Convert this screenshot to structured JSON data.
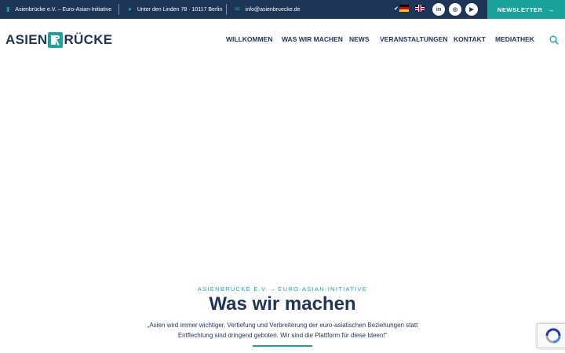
{
  "topbar": {
    "org": "Asienbrücke e.V. – Euro-Asian-Initiative",
    "address": "Unter den Linden 78 · 10117 Berlin",
    "email": "info@asienbruecke.de",
    "language_check": "✔",
    "social": [
      "in",
      "◎",
      "▶"
    ],
    "newsletter_label": "NEWSLETTER",
    "newsletter_arrow": "→"
  },
  "header": {
    "logo_left": "ASIEN",
    "logo_right": "RÜCKE",
    "nav": [
      "WILLKOMMEN",
      "WAS WIR MACHEN",
      "NEWS",
      "VERANSTALTUNGEN",
      "KONTAKT",
      "MEDIATHEK"
    ]
  },
  "hero": {
    "eyebrow": "ASIENBRÜCKE E.V. – EURO-ASIAN-INITIATIVE",
    "title": "Was wir machen",
    "quote_line1": "„Asien wird immer wichtiger. Vertiefung und Verbreiterung der euro-asiatischen Beziehungen statt",
    "quote_line2": "Entflechtung sind dringend geboten. Wir sind die Plattform für diese Ideen!“"
  },
  "colors": {
    "navy": "#1d3557",
    "teal": "#1aa39c",
    "white": "#ffffff"
  },
  "icons": {
    "org": "building-icon",
    "address": "map-pin-icon",
    "email": "envelope-icon",
    "search": "search-icon",
    "recaptcha": "recaptcha-icon"
  }
}
